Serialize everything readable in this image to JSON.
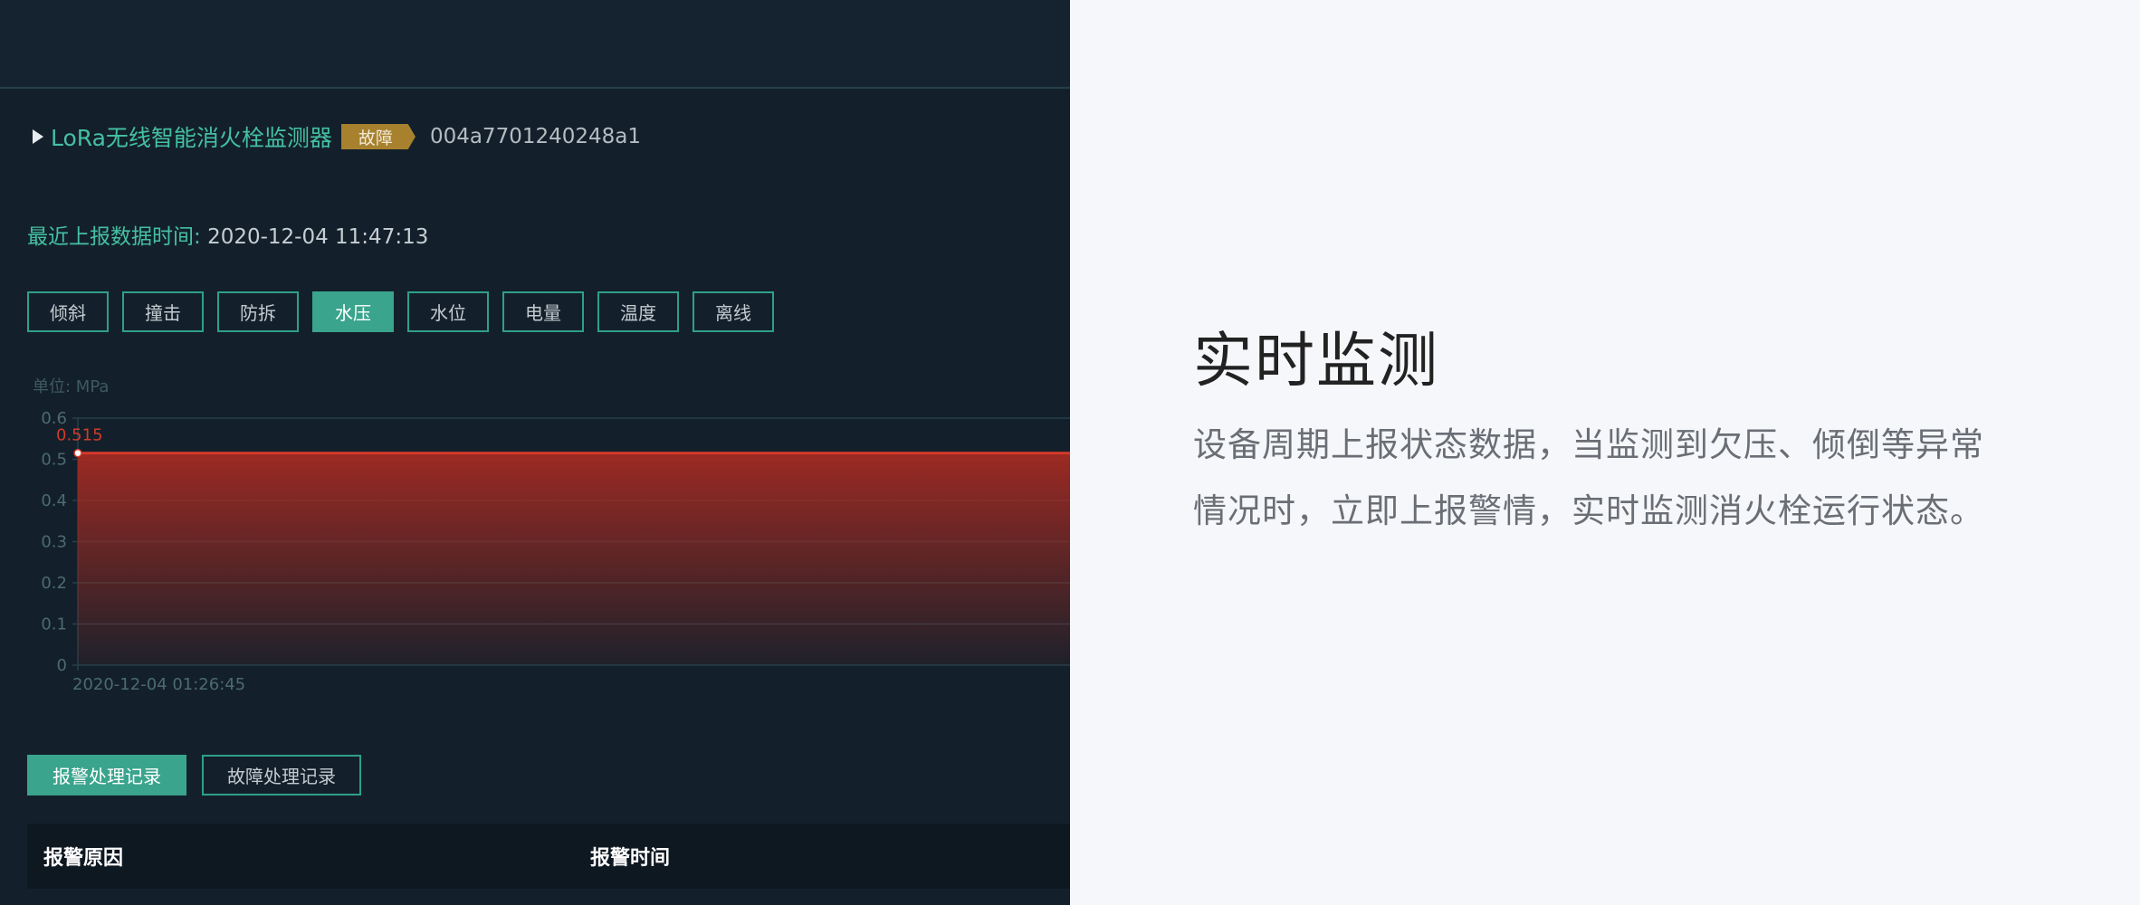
{
  "device": {
    "name": "LoRa无线智能消火栓监测器",
    "status": "故障",
    "id": "004a7701240248a1"
  },
  "report": {
    "label": "最近上报数据时间:",
    "value": "2020-12-04 11:47:13"
  },
  "tabs": [
    {
      "label": "倾斜",
      "active": false
    },
    {
      "label": "撞击",
      "active": false
    },
    {
      "label": "防拆",
      "active": false
    },
    {
      "label": "水压",
      "active": true
    },
    {
      "label": "水位",
      "active": false
    },
    {
      "label": "电量",
      "active": false
    },
    {
      "label": "温度",
      "active": false
    },
    {
      "label": "离线",
      "active": false
    }
  ],
  "chart_data": {
    "type": "area",
    "unit_label": "单位: MPa",
    "ylim": [
      0,
      0.6
    ],
    "y_ticks": [
      "0",
      "0.1",
      "0.2",
      "0.3",
      "0.4",
      "0.5",
      "0.6"
    ],
    "x_start_label": "2020-12-04 01:26:45",
    "series": [
      {
        "values": [
          0.515,
          0.515
        ]
      }
    ],
    "point_label": "0.515",
    "line_color": "#d23a2a",
    "grid": true
  },
  "records": {
    "alarm_button": "报警处理记录",
    "fault_button": "故障处理记录",
    "columns": [
      "报警原因",
      "报警时间"
    ]
  },
  "right": {
    "heading": "实时监测",
    "description": "设备周期上报状态数据，当监测到欠压、倾倒等异常情况时，立即上报警情，实时监测消火栓运行状态。"
  },
  "colors": {
    "accent": "#3aa48d",
    "badge": "#a8812f",
    "panel_bg": "#13202b"
  }
}
